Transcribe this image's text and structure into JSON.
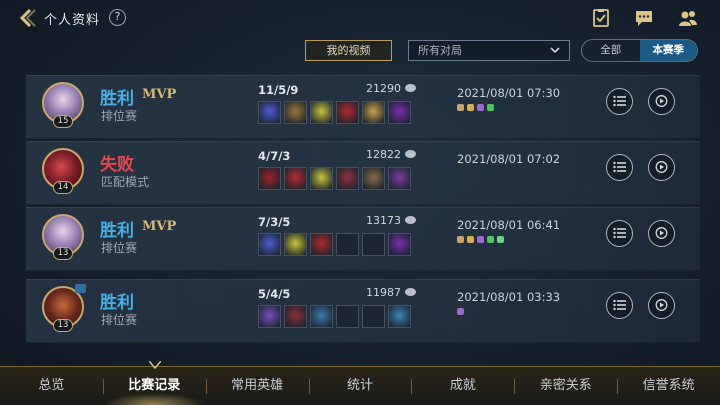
{
  "header": {
    "title": "个人资料",
    "help_label": "?"
  },
  "filters": {
    "my_videos_label": "我的视频",
    "mode_select_value": "所有对局",
    "segment": [
      "全部",
      "本赛季"
    ],
    "segment_selected": "本赛季"
  },
  "matches": [
    {
      "result": "胜利",
      "outcome": "win",
      "mvp": "MVP",
      "mode": "排位赛",
      "level": "15",
      "kda": "11/5/9",
      "gold": "21290",
      "datetime": "2021/08/01 07:30",
      "items": [
        "#4b5fd0",
        "#a0763a",
        "#c9c23a",
        "#b02a2e",
        "#c7a24a",
        "#7a2db0"
      ],
      "runes": [
        "#c9a56a",
        "#d4b24a",
        "#9b6ad0",
        "#4fc65a"
      ]
    },
    {
      "result": "失败",
      "outcome": "lose",
      "mvp": "",
      "mode": "匹配模式",
      "level": "14",
      "kda": "4/7/3",
      "gold": "12822",
      "datetime": "2021/08/01 07:02",
      "items": [
        "#9e2228",
        "#b62b30",
        "#c9c23a",
        "#8a3440",
        "#8a6a48",
        "#7a3fa0"
      ],
      "runes": []
    },
    {
      "result": "胜利",
      "outcome": "win",
      "mvp": "MVP",
      "mode": "排位赛",
      "level": "13",
      "kda": "7/3/5",
      "gold": "13173",
      "datetime": "2021/08/01 06:41",
      "items": [
        "#4b5fd0",
        "#c9c23a",
        "#b02a2e",
        "",
        "",
        "#7a2db0"
      ],
      "runes": [
        "#c9a56a",
        "#d4b24a",
        "#9b6ad0",
        "#4fc65a",
        "#6ad08a"
      ]
    },
    {
      "result": "胜利",
      "outcome": "win",
      "mvp": "",
      "mode": "排位赛",
      "level": "13",
      "kda": "5/4/5",
      "gold": "11987",
      "datetime": "2021/08/01 03:33",
      "items": [
        "#7a4fc0",
        "#8a2f3a",
        "#3f78b0",
        "",
        "",
        "#3a86b8"
      ],
      "runes": [
        "#9b6ad0"
      ]
    }
  ],
  "bottom_tabs": [
    "总览",
    "比赛记录",
    "常用英雄",
    "统计",
    "成就",
    "亲密关系",
    "信誉系统"
  ],
  "active_tab": "比赛记录",
  "colors": {
    "win": "#45b0e6",
    "lose": "#e4474c",
    "mvp": "#d7b877",
    "accent": "#1b5a85"
  }
}
